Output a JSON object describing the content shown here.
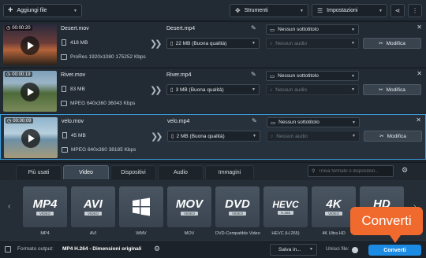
{
  "toolbar": {
    "add_files": "Aggiungi file",
    "tools": "Strumenti",
    "settings": "Impostazioni"
  },
  "files": [
    {
      "time": "00:00:20",
      "source_name": "Desert.mov",
      "source_size": "418 MB",
      "source_info": "ProRes 1920x1080 175252 Kbps",
      "dest_name": "Desert.mp4",
      "dest_size": "22 MB (Buona qualità)",
      "subtitle": "Nessun sottotitolo",
      "audio": "Nessun audio",
      "edit": "Modifica",
      "thumb_colors": [
        "#2b2a3d",
        "#b6643a",
        "#2a2119"
      ]
    },
    {
      "time": "00:00:19",
      "source_name": "River.mov",
      "source_size": "83 MB",
      "source_info": "MPEG 640x360 36043 Kbps",
      "dest_name": "River.mp4",
      "dest_size": "3 MB (Buona qualità)",
      "subtitle": "Nessun sottotitolo",
      "audio": "Nessun audio",
      "edit": "Modifica",
      "thumb_colors": [
        "#7d9fb8",
        "#4e6a3a",
        "#7a8a5a"
      ]
    },
    {
      "time": "00:00:09",
      "source_name": "velo.mov",
      "source_size": "45 MB",
      "source_info": "MPEG 640x360 38185 Kbps",
      "dest_name": "velo.mp4",
      "dest_size": "2 MB (Buona qualità)",
      "subtitle": "Nessun sottotitolo",
      "audio": "Nessun audio",
      "edit": "Modifica",
      "thumb_colors": [
        "#8eb3cc",
        "#6c8fa5",
        "#a69a7a"
      ]
    }
  ],
  "tabs": [
    "Più usati",
    "Video",
    "Dispositivi",
    "Audio",
    "Immagini"
  ],
  "active_tab": "Video",
  "search_placeholder": "Trova formato o dispositivo...",
  "formats": [
    {
      "big": "MP4",
      "sub": "VIDEO",
      "label": "MP4"
    },
    {
      "big": "AVI",
      "sub": "VIDEO",
      "label": "AVI"
    },
    {
      "big": "",
      "sub": "",
      "label": "WMV"
    },
    {
      "big": "MOV",
      "sub": "VIDEO",
      "label": "MOV"
    },
    {
      "big": "DVD",
      "sub": "VIDEO",
      "label": "DVD-Compatible Video"
    },
    {
      "big": "HEVC",
      "sub": "H.265",
      "label": "HEVC (H.265)"
    },
    {
      "big": "4K",
      "sub": "VIDEO",
      "label": "4K Ultra HD"
    },
    {
      "big": "HD",
      "sub": "VIDEO",
      "label": ""
    }
  ],
  "footer": {
    "output_label": "Formato output:",
    "output_value": "MP4 H.264 - Dimensioni originali",
    "save": "Salva in...",
    "merge": "Unisci file:",
    "convert": "Converti"
  },
  "callout": "Converti",
  "colors": {
    "accent": "#1c8be3",
    "callout": "#f06a2e",
    "selection": "#3c9fe0"
  }
}
